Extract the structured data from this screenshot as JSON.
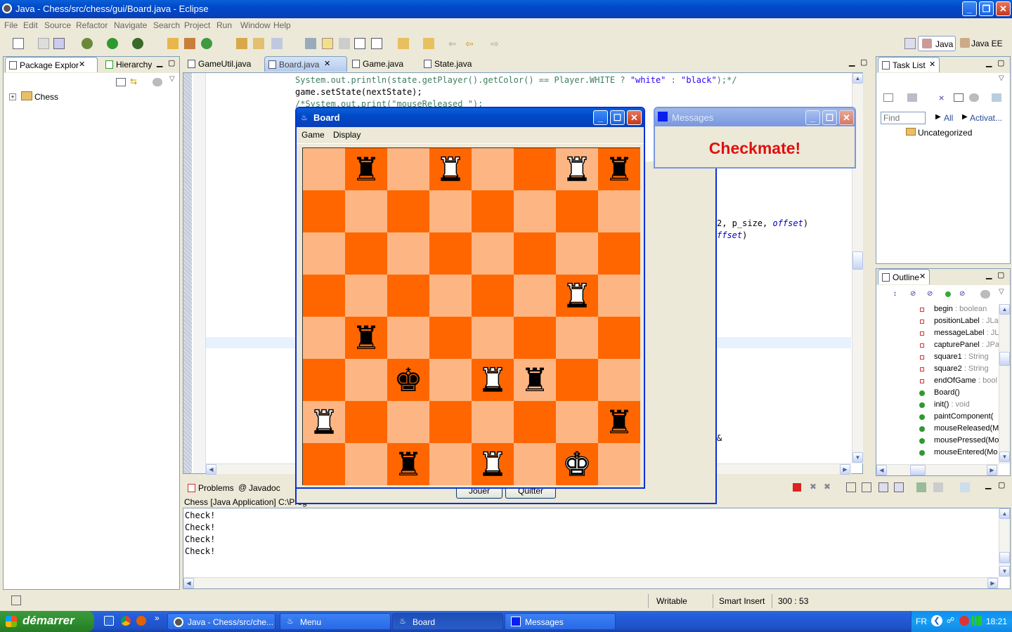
{
  "window": {
    "title": "Java - Chess/src/chess/gui/Board.java - Eclipse"
  },
  "menubar": [
    "File",
    "Edit",
    "Source",
    "Refactor",
    "Navigate",
    "Search",
    "Project",
    "Run",
    "Window",
    "Help"
  ],
  "perspectives": {
    "java": "Java",
    "javaee": "Java EE"
  },
  "left_tabs": {
    "package_explorer": "Package Explor",
    "hierarchy": "Hierarchy"
  },
  "tree": {
    "project": "Chess"
  },
  "editor_tabs": [
    "GameUtil.java",
    "Board.java",
    "Game.java",
    "State.java"
  ],
  "code": {
    "line1_pre": "System.out.println(state.getPlayer().getColor() == Player.WHITE ? ",
    "line1_s1": "\"white\"",
    "line1_mid": " : ",
    "line1_s2": "\"black\"",
    "line1_post": ");*/",
    "line2": "game.setState(nextState);",
    "line3": "/*System.out.print(\"mouseReleased \");",
    "frag1_a": "2, p_size, ",
    "frag1_b": "offset",
    "frag1_c": ")",
    "frag2_a": "ffset",
    "frag2_b": ")",
    "frag3": "&"
  },
  "task_list": {
    "title": "Task List",
    "find_placeholder": "Find",
    "all": "All",
    "activate": "Activat...",
    "uncategorized": "Uncategorized"
  },
  "outline": {
    "title": "Outline",
    "items": [
      {
        "name": "begin",
        "type": " : boolean",
        "kind": "field"
      },
      {
        "name": "positionLabel",
        "type": " : JLa",
        "kind": "field"
      },
      {
        "name": "messageLabel",
        "type": " : JL",
        "kind": "field"
      },
      {
        "name": "capturePanel",
        "type": " : JPa",
        "kind": "field"
      },
      {
        "name": "square1",
        "type": " : String",
        "kind": "field"
      },
      {
        "name": "square2",
        "type": " : String",
        "kind": "field"
      },
      {
        "name": "endOfGame",
        "type": " : bool",
        "kind": "field"
      },
      {
        "name": "Board()",
        "type": "",
        "kind": "ctor"
      },
      {
        "name": "init()",
        "type": " : void",
        "kind": "method"
      },
      {
        "name": "paintComponent(",
        "type": "",
        "kind": "method"
      },
      {
        "name": "mouseReleased(M",
        "type": "",
        "kind": "method"
      },
      {
        "name": "mousePressed(Mo",
        "type": "",
        "kind": "method"
      },
      {
        "name": "mouseEntered(Mo",
        "type": "",
        "kind": "method"
      }
    ]
  },
  "board_window": {
    "title": "Board",
    "menu": [
      "Game",
      "Display"
    ],
    "buttons": {
      "play": "Jouer",
      "quit": "Quitter"
    },
    "squares": [
      [
        "",
        "bR",
        "",
        "wR",
        "",
        "",
        "wR",
        "bR"
      ],
      [
        "",
        "",
        "",
        "",
        "",
        "",
        "",
        ""
      ],
      [
        "",
        "",
        "",
        "",
        "",
        "",
        "",
        ""
      ],
      [
        "",
        "",
        "",
        "",
        "",
        "",
        "wR",
        ""
      ],
      [
        "",
        "bR",
        "",
        "",
        "",
        "",
        "",
        ""
      ],
      [
        "",
        "",
        "bK",
        "",
        "wR",
        "bR",
        "",
        ""
      ],
      [
        "wR",
        "",
        "",
        "",
        "",
        "",
        "",
        "bR"
      ],
      [
        "",
        "",
        "bR",
        "",
        "wR",
        "",
        "wK",
        ""
      ]
    ],
    "colors": {
      "light": "#fdb683",
      "dark": "#ff6600"
    }
  },
  "messages_window": {
    "title": "Messages",
    "text": "Checkmate!",
    "text_color": "#e01010"
  },
  "bottom_tabs": {
    "problems": "Problems",
    "javadoc": "Javadoc"
  },
  "console": {
    "header": "Chess [Java Application] C:\\Prog",
    "lines": [
      "Check!",
      "Check!",
      "Check!",
      "Check!"
    ]
  },
  "status": {
    "mode": "Writable",
    "insert": "Smart Insert",
    "position": "300 : 53"
  },
  "taskbar": {
    "start": "démarrer",
    "tasks": [
      "Java - Chess/src/che...",
      "Menu",
      "Board",
      "Messages"
    ],
    "lang": "FR",
    "clock": "18:21"
  }
}
